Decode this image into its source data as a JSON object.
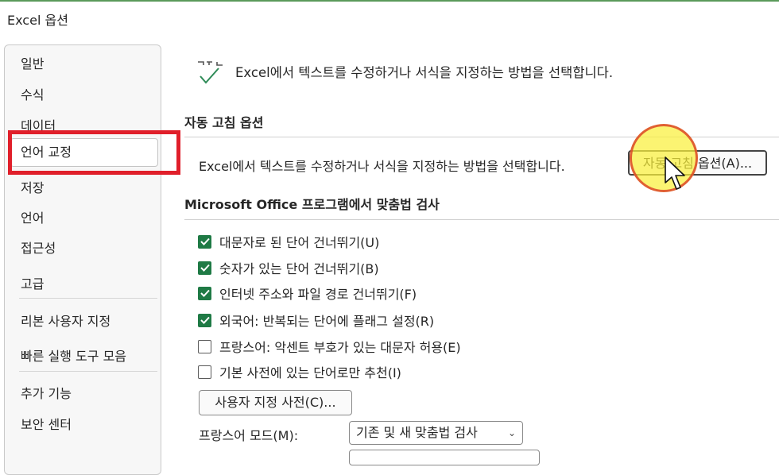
{
  "window": {
    "title": "Excel 옵션"
  },
  "sidebar": {
    "items": [
      {
        "label": "일반"
      },
      {
        "label": "수식"
      },
      {
        "label": "데이터"
      },
      {
        "label": "언어 교정",
        "selected": true
      },
      {
        "label": "저장"
      },
      {
        "label": "언어"
      },
      {
        "label": "접근성"
      },
      {
        "label": "고급"
      },
      {
        "label": "리본 사용자 지정"
      },
      {
        "label": "빠른 실행 도구 모음"
      },
      {
        "label": "추가 기능"
      },
      {
        "label": "보안 센터"
      }
    ]
  },
  "main": {
    "header_text": "Excel에서 텍스트를 수정하거나 서식을 지정하는 방법을 선택합니다.",
    "autocorrect": {
      "section_title": "자동 고침 옵션",
      "description": "Excel에서 텍스트를 수정하거나 서식을 지정하는 방법을 선택합니다.",
      "button_label": "자동 고침 옵션(A)..."
    },
    "spelling": {
      "section_title": "Microsoft Office 프로그램에서 맞춤법 검사",
      "options": [
        {
          "label": "대문자로 된 단어 건너뛰기(U)",
          "checked": true
        },
        {
          "label": "숫자가 있는 단어 건너뛰기(B)",
          "checked": true
        },
        {
          "label": "인터넷 주소와 파일 경로 건너뛰기(F)",
          "checked": true
        },
        {
          "label": "외국어: 반복되는 단어에 플래그 설정(R)",
          "checked": true
        },
        {
          "label": "프랑스어: 악센트 부호가 있는 대문자 허용(E)",
          "checked": false
        },
        {
          "label": "기본 사전에 있는 단어로만 추천(I)",
          "checked": false
        }
      ],
      "custom_dict_button": "사용자 지정 사전(C)...",
      "french_mode_label": "프랑스어 모드(M):",
      "french_mode_value": "기존 및 새 맞춤법 검사"
    }
  },
  "colors": {
    "selection_box": "#e01f2a",
    "checkbox_checked": "#1f7a45",
    "highlight": "#f5ec3c"
  },
  "icons": {
    "header": "abc-check-icon",
    "checkmark": "checkmark-icon",
    "dropdown": "chevron-down-icon",
    "cursor": "mouse-pointer-icon"
  }
}
